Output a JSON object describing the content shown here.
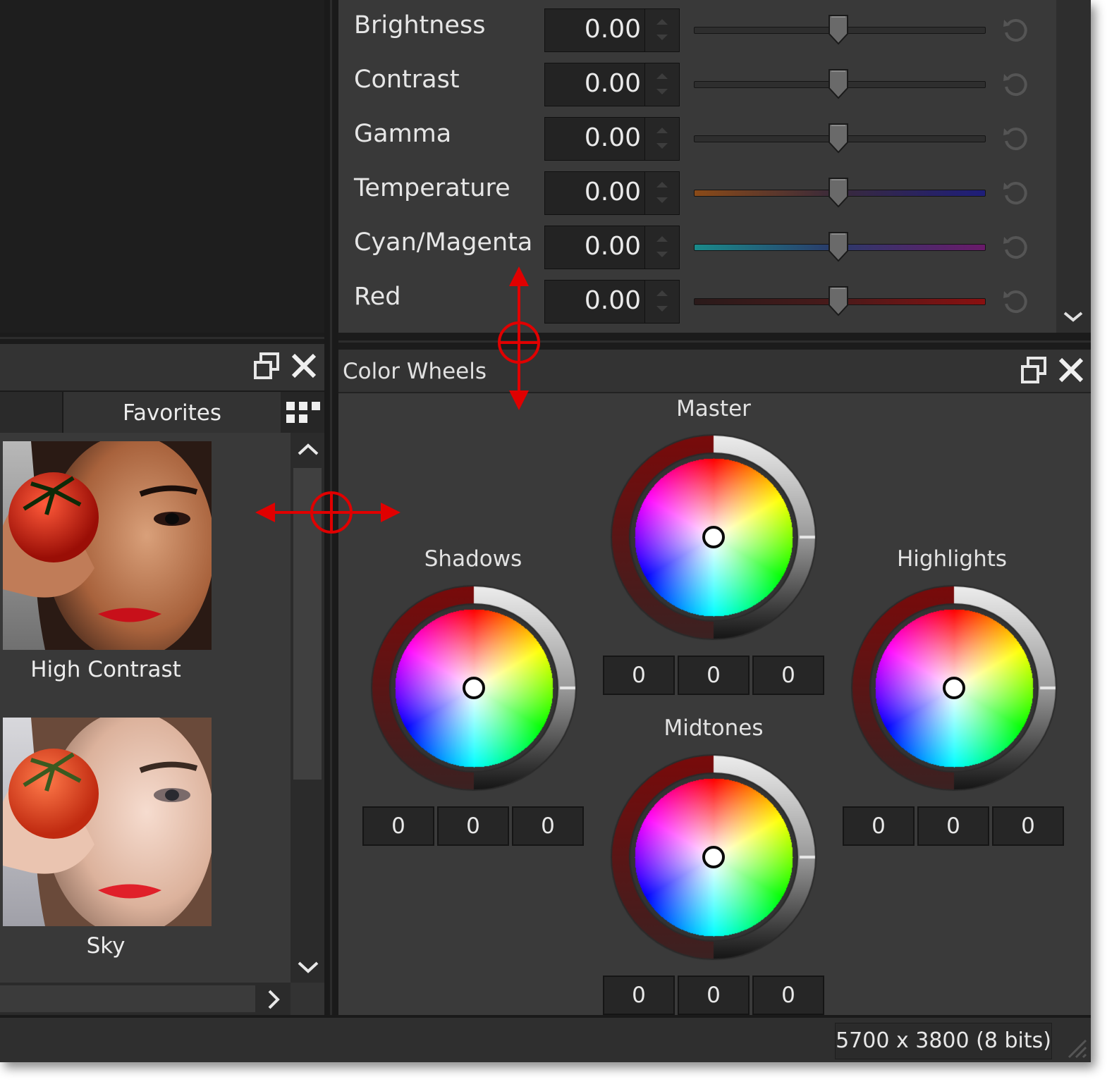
{
  "adjustments": {
    "rows": [
      {
        "label": "Brightness",
        "value": "0.00",
        "track": "gray"
      },
      {
        "label": "Contrast",
        "value": "0.00",
        "track": "gray"
      },
      {
        "label": "Gamma",
        "value": "0.00",
        "track": "gray"
      },
      {
        "label": "Temperature",
        "value": "0.00",
        "track": "temperature"
      },
      {
        "label": "Cyan/Magenta",
        "value": "0.00",
        "track": "cyan-magenta"
      },
      {
        "label": "Red",
        "value": "0.00",
        "track": "red"
      }
    ]
  },
  "presets": {
    "tab_label": "Favorites",
    "items": [
      {
        "caption": "High Contrast"
      },
      {
        "caption": "Sky"
      }
    ]
  },
  "color_wheels": {
    "title": "Color Wheels",
    "master": {
      "label": "Master",
      "values": [
        "0",
        "0",
        "0"
      ]
    },
    "shadows": {
      "label": "Shadows",
      "values": [
        "0",
        "0",
        "0"
      ]
    },
    "highlights": {
      "label": "Highlights",
      "values": [
        "0",
        "0",
        "0"
      ]
    },
    "midtones": {
      "label": "Midtones",
      "values": [
        "0",
        "0",
        "0"
      ]
    }
  },
  "status": {
    "dimensions": "5700 x 3800 (8 bits)"
  },
  "colors": {
    "panel_bg": "#393939",
    "dark_bg": "#1e1e1e",
    "accent_red": "#e00000"
  },
  "icons": [
    "restore-window-icon",
    "close-icon",
    "grid-view-icon",
    "reset-icon",
    "chevron-up-icon",
    "chevron-down-icon",
    "chevron-right-icon",
    "resize-grip-icon"
  ]
}
